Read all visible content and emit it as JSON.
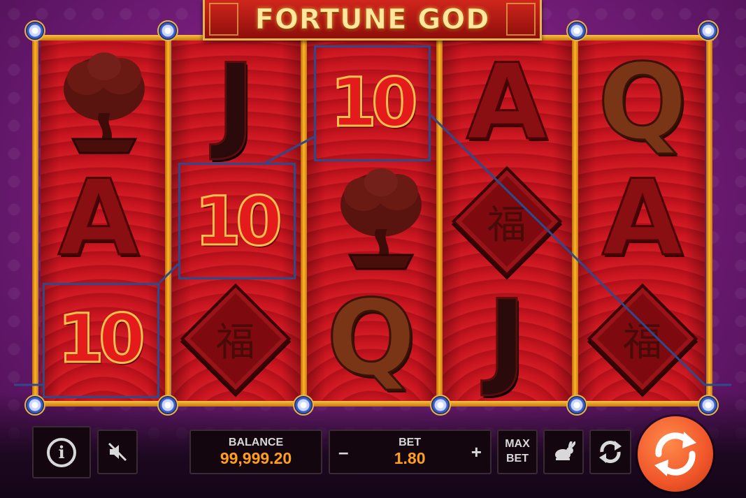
{
  "game": {
    "title": "FORTUNE GOD"
  },
  "reels": [
    [
      "bonsai-tree",
      "A",
      "10"
    ],
    [
      "J",
      "10",
      "fu-diamond"
    ],
    [
      "10",
      "bonsai-tree",
      "Q"
    ],
    [
      "A",
      "fu-diamond",
      "J"
    ],
    [
      "Q",
      "A",
      "fu-diamond"
    ]
  ],
  "symbols": {
    "ten": "10",
    "ace": "A",
    "jack": "J",
    "queen": "Q",
    "fu": "福"
  },
  "winning_line": {
    "positions": [
      [
        0,
        2
      ],
      [
        1,
        1
      ],
      [
        2,
        0
      ],
      [
        3,
        1
      ],
      [
        4,
        2
      ]
    ],
    "matched_symbol": "10",
    "color": "#2d4a8c"
  },
  "controls": {
    "info_icon": "info-icon",
    "sound_icon": "muted-speaker-icon",
    "balance_label": "BALANCE",
    "balance_value": "99,999.20",
    "bet_label": "BET",
    "bet_value": "1.80",
    "bet_minus": "–",
    "bet_plus": "+",
    "maxbet_line1": "MAX",
    "maxbet_line2": "BET",
    "turbo_icon": "rabbit-icon",
    "autoplay_icon": "autoplay-icon",
    "spin_icon": "spin-icon"
  },
  "colors": {
    "accent_orange": "#ff9f1a",
    "spin_button": "#f0562a",
    "reel_red": "#c41420",
    "frame_gold": "#ffb32a",
    "background_purple": "#7a1f7f"
  }
}
